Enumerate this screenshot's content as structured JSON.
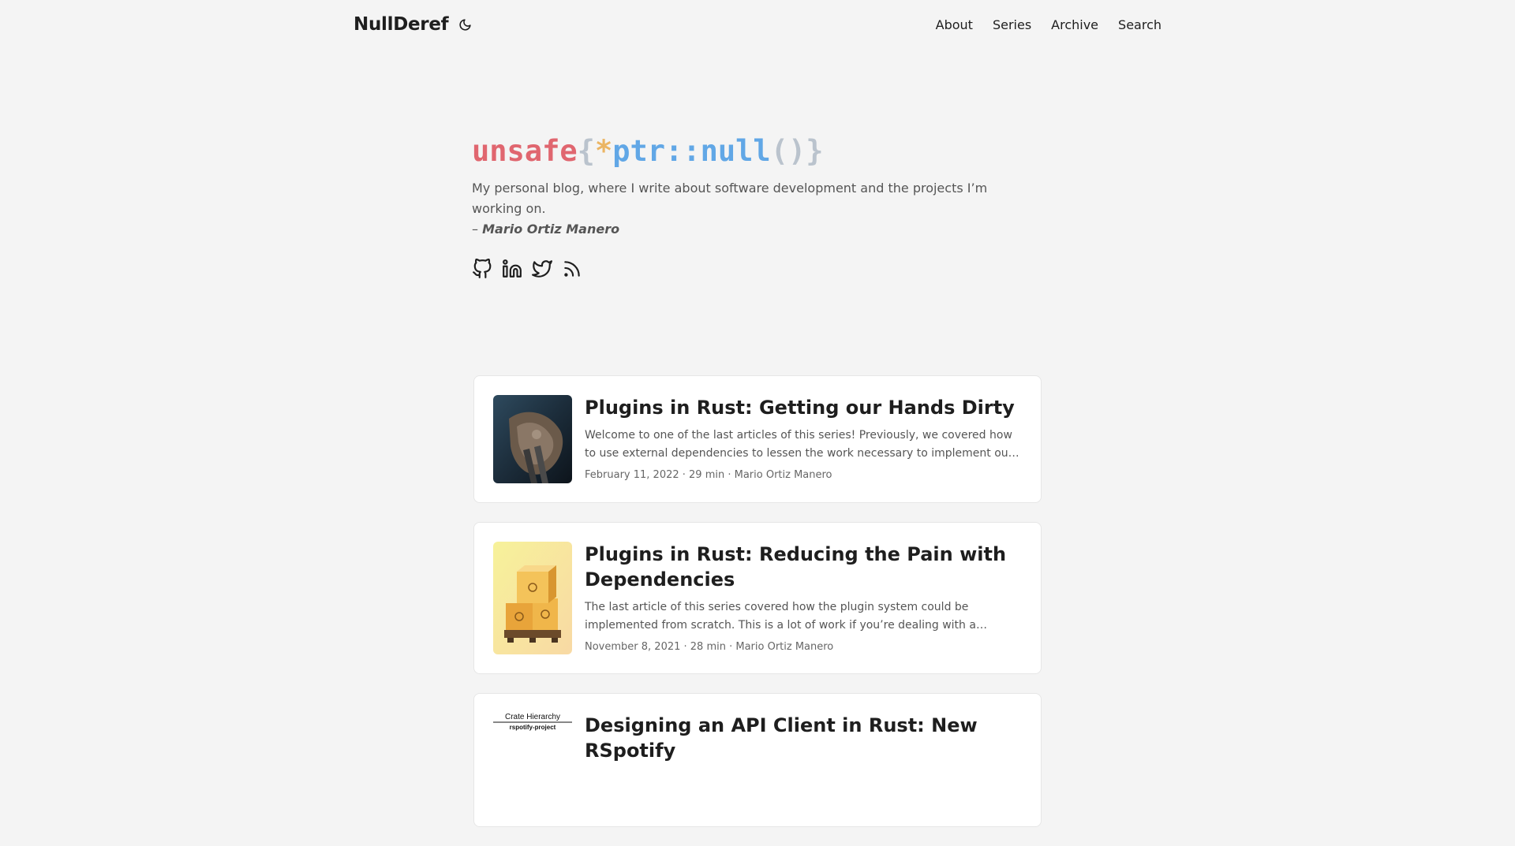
{
  "site": {
    "name": "NullDeref",
    "nav": [
      "About",
      "Series",
      "Archive",
      "Search"
    ]
  },
  "hero": {
    "title_parts": [
      "unsafe",
      "{",
      "*",
      "ptr::null",
      "()",
      "}"
    ],
    "description": "My personal blog, where I write about software development and the projects I’m working on.",
    "author_prefix": "– ",
    "author": "Mario Ortiz Manero",
    "socials": [
      "github-icon",
      "linkedin-icon",
      "twitter-icon",
      "rss-icon"
    ]
  },
  "colors": {
    "background": "#f4f4f4",
    "title_red": "#e0666f",
    "title_gray": "#bac3cd",
    "title_orange": "#ebb563",
    "title_blue": "#61a7e6"
  },
  "posts": [
    {
      "title": "Plugins in Rust: Getting our Hands Dirty",
      "excerpt": "Welcome to one of the last articles of this series! Previously, we covered how to use external dependencies to lessen the work necessary to implement our plugin system.…",
      "meta": "February 11, 2022 · 29 min · Mario Ortiz Manero"
    },
    {
      "title": "Plugins in Rust: Reducing the Pain with Dependencies",
      "excerpt": "The last article of this series covered how the plugin system could be implemented from scratch. This is a lot of work if you’re dealing with a relatively large codebase and…",
      "meta": "November 8, 2021 · 28 min · Mario Ortiz Manero"
    },
    {
      "title": "Designing an API Client in Rust: New RSpotify",
      "thumb_heading": "Crate Hierarchy",
      "thumb_sub": "rspotify-project"
    }
  ]
}
